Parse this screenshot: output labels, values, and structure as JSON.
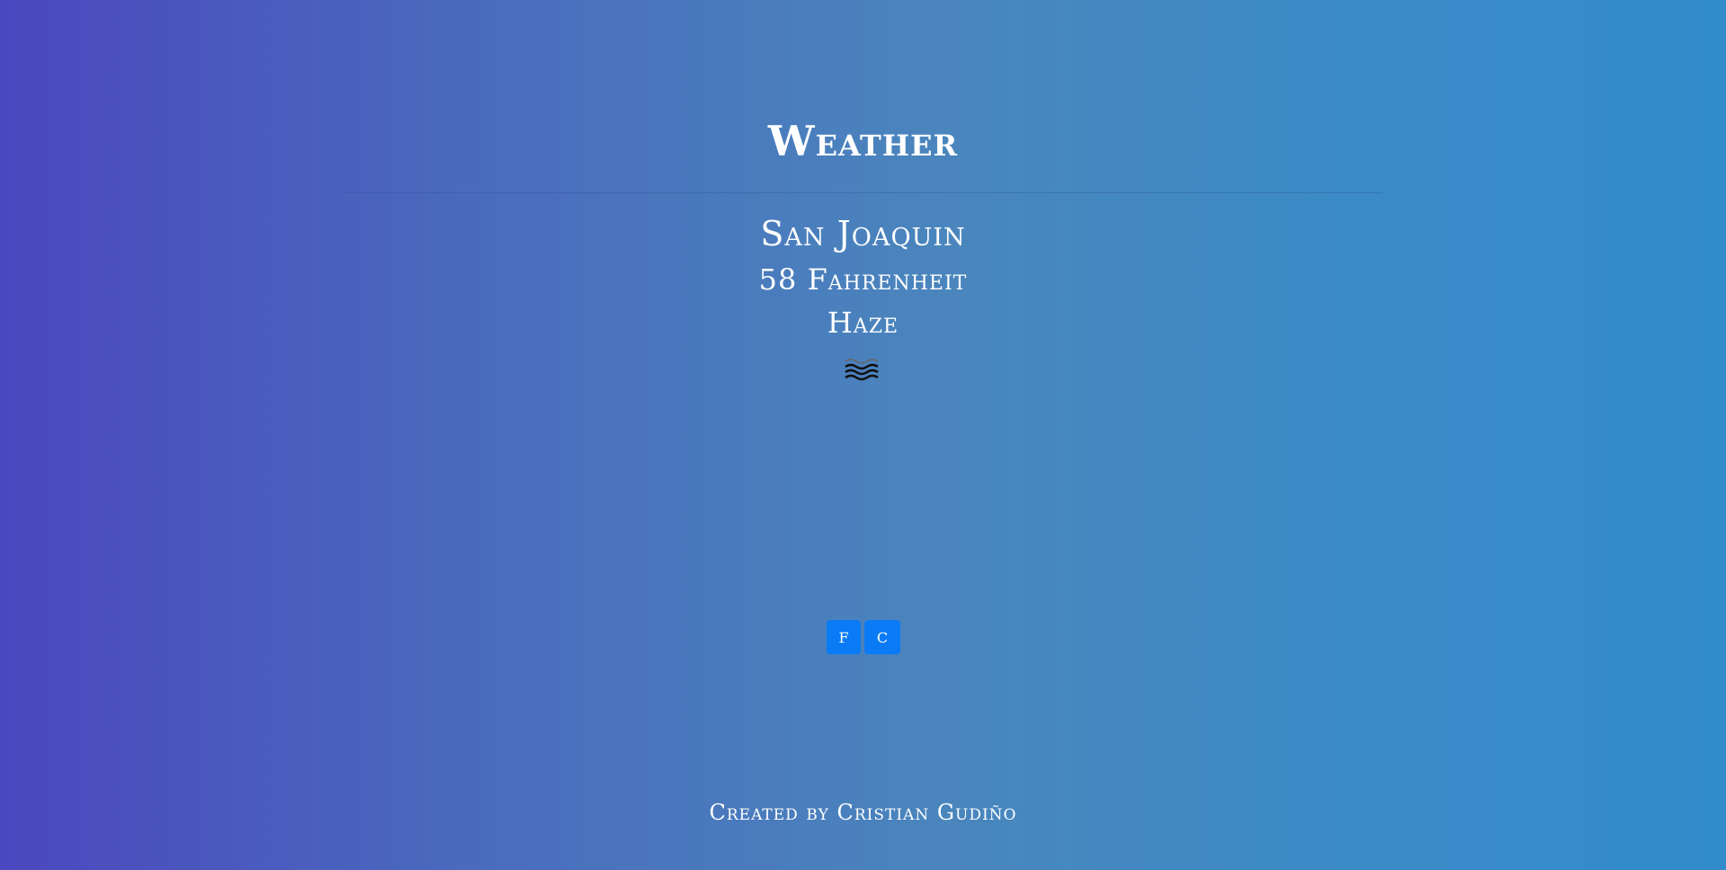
{
  "header": {
    "title": "Weather"
  },
  "weather": {
    "city": "San Joaquin",
    "temperature": "58 Fahrenheit",
    "condition": "Haze",
    "icon": "haze-icon"
  },
  "units": {
    "fahrenheit_label": "F",
    "celsius_label": "C"
  },
  "footer": {
    "credit": "Created by Cristian Gudiño"
  },
  "colors": {
    "gradient_start": "#4b48bf",
    "gradient_end": "#328bcb",
    "button": "#0a7bf5",
    "text": "#ffffff"
  }
}
